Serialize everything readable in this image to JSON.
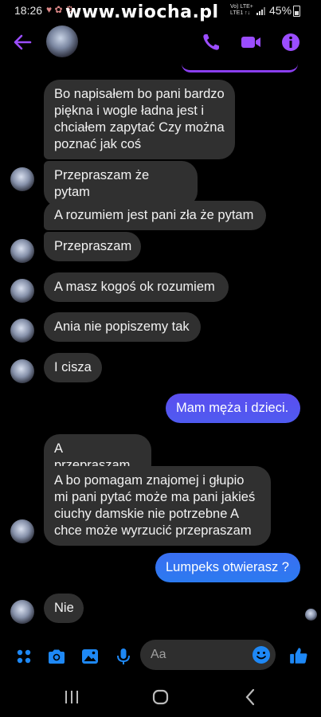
{
  "status_bar": {
    "time": "18:26",
    "watermark": "www.wiocha.pl",
    "network_line1": "Vo) LTE+",
    "network_line2": "LTE1 ↑↓",
    "battery": "45%"
  },
  "header": {
    "back_icon": "arrow-left-icon",
    "call_icon": "phone-icon",
    "video_icon": "video-camera-icon",
    "info_icon": "info-icon",
    "accent": "#9b4dff"
  },
  "messages": [
    {
      "side": "in",
      "text": "Bo napisałem bo pani bardzo piękna i wogle ładna jest i chciałem zapytać Czy można poznać jak coś"
    },
    {
      "side": "in",
      "text": "Przepraszam że pytam"
    },
    {
      "side": "in",
      "text": "A rozumiem jest pani zła że pytam"
    },
    {
      "side": "in",
      "text": "Przepraszam"
    },
    {
      "side": "in",
      "text": "A masz kogoś ok rozumiem"
    },
    {
      "side": "in",
      "text": "Ania nie popiszemy tak"
    },
    {
      "side": "in",
      "text": "I cisza"
    },
    {
      "side": "out",
      "text": "Mam męża i dzieci."
    },
    {
      "side": "in",
      "text": "A przepraszam"
    },
    {
      "side": "in",
      "text": "A bo pomagam znajomej i głupio mi pani pytać może ma pani jakieś ciuchy damskie nie potrzebne A chce może wyrzucić przepraszam"
    },
    {
      "side": "out",
      "text": "Lumpeks otwierasz ?"
    },
    {
      "side": "in",
      "text": "Nie"
    }
  ],
  "composer": {
    "placeholder": "Aa",
    "icons": [
      "apps-grid-icon",
      "camera-icon",
      "image-icon",
      "microphone-icon",
      "emoji-icon",
      "thumbs-up-icon"
    ],
    "accent": "#1e88f5"
  },
  "colors": {
    "incoming_bubble": "#303030",
    "outgoing_top": "#5a4ef0",
    "outgoing_bottom": "#2b77f0"
  }
}
